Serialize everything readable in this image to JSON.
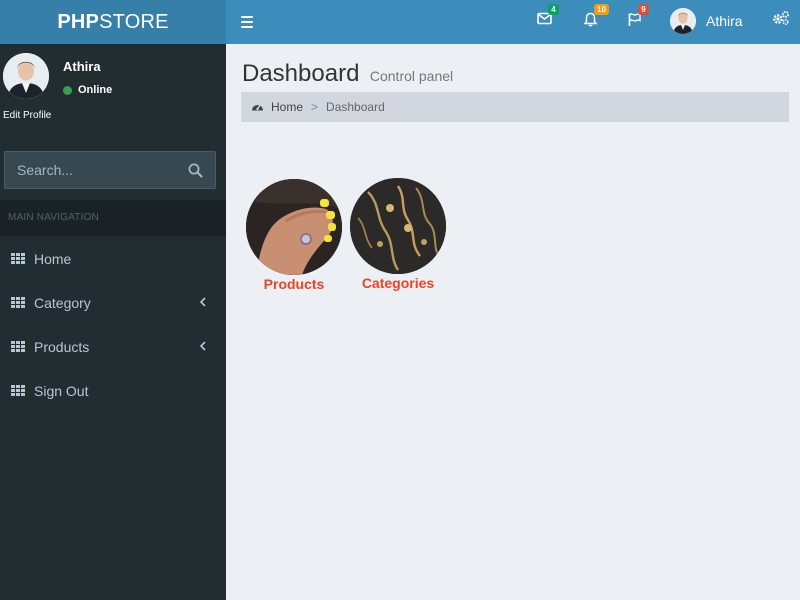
{
  "header": {
    "logo_bold": "PHP",
    "logo_light": "STORE",
    "mail_count": "4",
    "notifications_count": "10",
    "flags_count": "9",
    "user_name": "Athira",
    "colors": {
      "logo_bg": "#367fa9",
      "navbar_bg": "#3c8dbc",
      "badge_green": "#00a65a",
      "badge_yellow": "#f39c12",
      "badge_red": "#dd4b39"
    }
  },
  "sidebar": {
    "user_name": "Athira",
    "status": "Online",
    "edit_profile": "Edit Profile",
    "search_placeholder": "Search...",
    "nav_header": "MAIN NAVIGATION",
    "items": [
      {
        "label": "Home",
        "icon": "grid-icon",
        "has_chevron": false
      },
      {
        "label": "Category",
        "icon": "grid-icon",
        "has_chevron": true
      },
      {
        "label": "Products",
        "icon": "grid-icon",
        "has_chevron": true
      },
      {
        "label": "Sign Out",
        "icon": "grid-icon",
        "has_chevron": false
      }
    ]
  },
  "content": {
    "title": "Dashboard",
    "subtitle": "Control panel",
    "breadcrumb": {
      "home": "Home",
      "separator": ">",
      "current": "Dashboard"
    },
    "tiles": [
      {
        "label": "Products",
        "image": "hand-with-ring-photo"
      },
      {
        "label": "Categories",
        "image": "jewelry-photo"
      }
    ],
    "accent_color": "#f04124"
  }
}
